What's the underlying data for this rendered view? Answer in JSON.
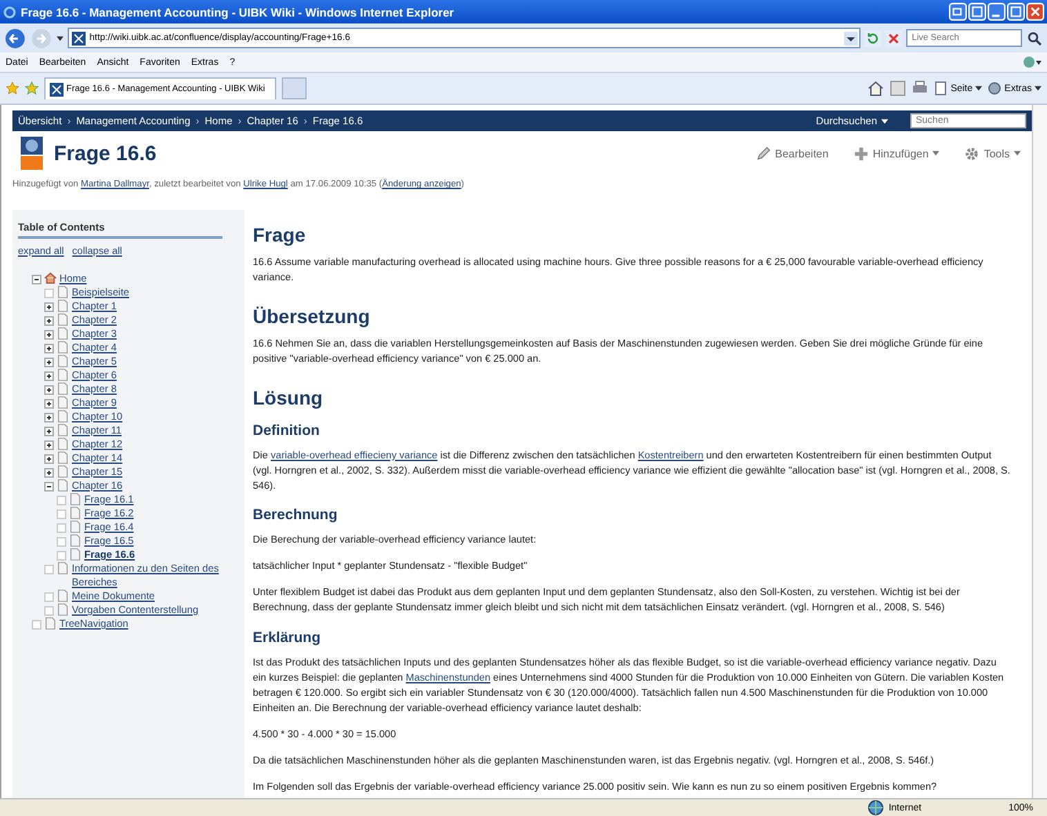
{
  "window": {
    "title": "Frage 16.6 - Management Accounting - UIBK Wiki - Windows Internet Explorer"
  },
  "address_bar": {
    "url": "http://wiki.uibk.ac.at/confluence/display/accounting/Frage+16.6",
    "search_placeholder": "Live Search"
  },
  "menu": [
    "Datei",
    "Bearbeiten",
    "Ansicht",
    "Favoriten",
    "Extras",
    "?"
  ],
  "tabs": [
    {
      "label": "Frage 16.6 - Management Accounting - UIBK Wiki",
      "selected": true
    }
  ],
  "command_bar": [
    "Seite",
    "Extras"
  ],
  "breadcrumb": {
    "items": [
      "Übersicht",
      "Management Accounting",
      "Home",
      "Chapter 16",
      "Frage 16.6"
    ],
    "separator": "›"
  },
  "site_search": {
    "label": "Durchsuchen",
    "placeholder": "Suchen"
  },
  "page": {
    "title": "Frage 16.6",
    "actions": [
      "Bearbeiten",
      "Hinzufügen",
      "Tools"
    ],
    "meta": [
      {
        "text": "Hinzugefügt von "
      },
      {
        "text": "Martina Dallmayr",
        "link": true
      },
      {
        "text": ", zuletzt bearbeitet von "
      },
      {
        "text": "Ulrike Hugl",
        "link": true
      },
      {
        "text": " am 17.06.2009 10:35  ("
      },
      {
        "text": "Änderung anzeigen",
        "link": true
      },
      {
        "text": ")"
      }
    ]
  },
  "toc": {
    "title": "Table of Contents",
    "actions": [
      "expand all",
      "collapse all"
    ],
    "tree": [
      {
        "label": "Home",
        "kind": "branch",
        "expanded": true,
        "children": [
          {
            "label": "Beispielseite",
            "kind": "leaf"
          },
          {
            "label": "Chapter 1",
            "kind": "branch",
            "expanded": false
          },
          {
            "label": "Chapter 2",
            "kind": "branch",
            "expanded": false
          },
          {
            "label": "Chapter 3",
            "kind": "branch",
            "expanded": false
          },
          {
            "label": "Chapter 4",
            "kind": "branch",
            "expanded": false
          },
          {
            "label": "Chapter 5",
            "kind": "branch",
            "expanded": false
          },
          {
            "label": "Chapter 6",
            "kind": "branch",
            "expanded": false
          },
          {
            "label": "Chapter 8",
            "kind": "branch",
            "expanded": false
          },
          {
            "label": "Chapter 9",
            "kind": "branch",
            "expanded": false
          },
          {
            "label": "Chapter 10",
            "kind": "branch",
            "expanded": false
          },
          {
            "label": "Chapter 11",
            "kind": "branch",
            "expanded": false
          },
          {
            "label": "Chapter 12",
            "kind": "branch",
            "expanded": false
          },
          {
            "label": "Chapter 14",
            "kind": "branch",
            "expanded": false
          },
          {
            "label": "Chapter 15",
            "kind": "branch",
            "expanded": false
          },
          {
            "label": "Chapter 16",
            "kind": "branch",
            "expanded": true,
            "children": [
              {
                "label": "Frage 16.1",
                "kind": "leaf"
              },
              {
                "label": "Frage 16.2",
                "kind": "leaf"
              },
              {
                "label": "Frage 16.4",
                "kind": "leaf"
              },
              {
                "label": "Frage 16.5",
                "kind": "leaf"
              },
              {
                "label": "Frage 16.6",
                "kind": "leaf",
                "current": true
              }
            ]
          },
          {
            "label": "Informationen zu den Seiten des Bereiches",
            "kind": "leaf"
          },
          {
            "label": "Meine Dokumente",
            "kind": "leaf"
          },
          {
            "label": "Vorgaben Contenterstellung",
            "kind": "leaf"
          }
        ]
      },
      {
        "label": "TreeNavigation",
        "kind": "leaf"
      }
    ]
  },
  "content": [
    {
      "kind": "h1",
      "text": "Frage"
    },
    {
      "kind": "p",
      "parts": [
        {
          "text": "16.6 Assume variable manufacturing overhead is allocated using machine hours. Give three possible reasons for a € 25,000 favourable variable-overhead efficiency variance."
        }
      ]
    },
    {
      "kind": "h1",
      "text": "Übersetzung"
    },
    {
      "kind": "p",
      "parts": [
        {
          "text": "16.6 Nehmen Sie an, dass die variablen Herstellungsgemeinkosten auf Basis der Maschinenstunden zugewiesen werden. Geben Sie drei mögliche Gründe für eine positive \"variable-overhead efficiency variance\" von € 25.000 an."
        }
      ]
    },
    {
      "kind": "h1",
      "text": "Lösung"
    },
    {
      "kind": "h2",
      "text": "Definition"
    },
    {
      "kind": "p",
      "parts": [
        {
          "text": "Die "
        },
        {
          "text": "variable-overhead effiecieny variance",
          "link": true
        },
        {
          "text": " ist die Differenz zwischen den tatsächlichen "
        },
        {
          "text": "Kostentreibern",
          "link": true
        },
        {
          "text": " und den erwarteten Kostentreibern für einen bestimmten Output (vgl. Horngren et al., 2002, S. 332). Außerdem misst die variable-overhead efficiency variance wie effizient die gewählte \"allocation base\" ist (vgl. Horngren et al., 2008, S. 546)."
        }
      ]
    },
    {
      "kind": "h2",
      "text": "Berechnung"
    },
    {
      "kind": "p",
      "parts": [
        {
          "text": "Die Berechung der variable-overhead efficiency variance lautet:"
        }
      ]
    },
    {
      "kind": "p",
      "parts": [
        {
          "text": "tatsächlicher Input * geplanter Stundensatz - \"flexible Budget\""
        }
      ]
    },
    {
      "kind": "p",
      "parts": [
        {
          "text": "Unter flexiblem Budget ist dabei das Produkt aus dem geplanten Input und dem geplanten Stundensatz, also den Soll-Kosten, zu verstehen. Wichtig ist bei der Berechnung, dass der geplante Stundensatz immer gleich bleibt und sich nicht mit dem tatsächlichen Einsatz verändert. (vgl. Horngren et al., 2008, S. 546)"
        }
      ]
    },
    {
      "kind": "h2",
      "text": "Erklärung"
    },
    {
      "kind": "p",
      "parts": [
        {
          "text": "Ist das Produkt des tatsächlichen Inputs und des geplanten Stundensatzes höher als das flexible Budget, so ist die variable-overhead efficiency variance negativ. Dazu ein kurzes Beispiel: die geplanten "
        },
        {
          "text": "Maschinenstunden",
          "link": true
        },
        {
          "text": " eines Unternehmens sind 4000 Stunden für die Produktion von 10.000 Einheiten von Gütern. Die variablen Kosten betragen € 120.000. So ergibt sich ein variabler Stundensatz von € 30 (120.000/4000). Tatsächlich fallen nun 4.500 Maschinenstunden für die Produktion von 10.000 Einheiten an. Die Berechnung der variable-overhead efficiency variance lautet deshalb:"
        }
      ]
    },
    {
      "kind": "p",
      "parts": [
        {
          "text": "4.500 * 30 - 4.000 * 30 = 15.000"
        }
      ]
    },
    {
      "kind": "p",
      "parts": [
        {
          "text": "Da die tatsächlichen Maschinenstunden höher als die geplanten Maschinenstunden waren, ist das Ergebnis negativ. (vgl. Horngren et al., 2008, S. 546f.)"
        }
      ]
    },
    {
      "kind": "p",
      "parts": [
        {
          "text": "Im Folgenden soll das Ergebnis der variable-overhead efficiency variance 25.000 positiv sein. Wie kann es nun zu so einem positiven Ergebnis kommen?"
        }
      ]
    }
  ],
  "status_bar": {
    "zone": "Internet",
    "zoom": "100%"
  }
}
